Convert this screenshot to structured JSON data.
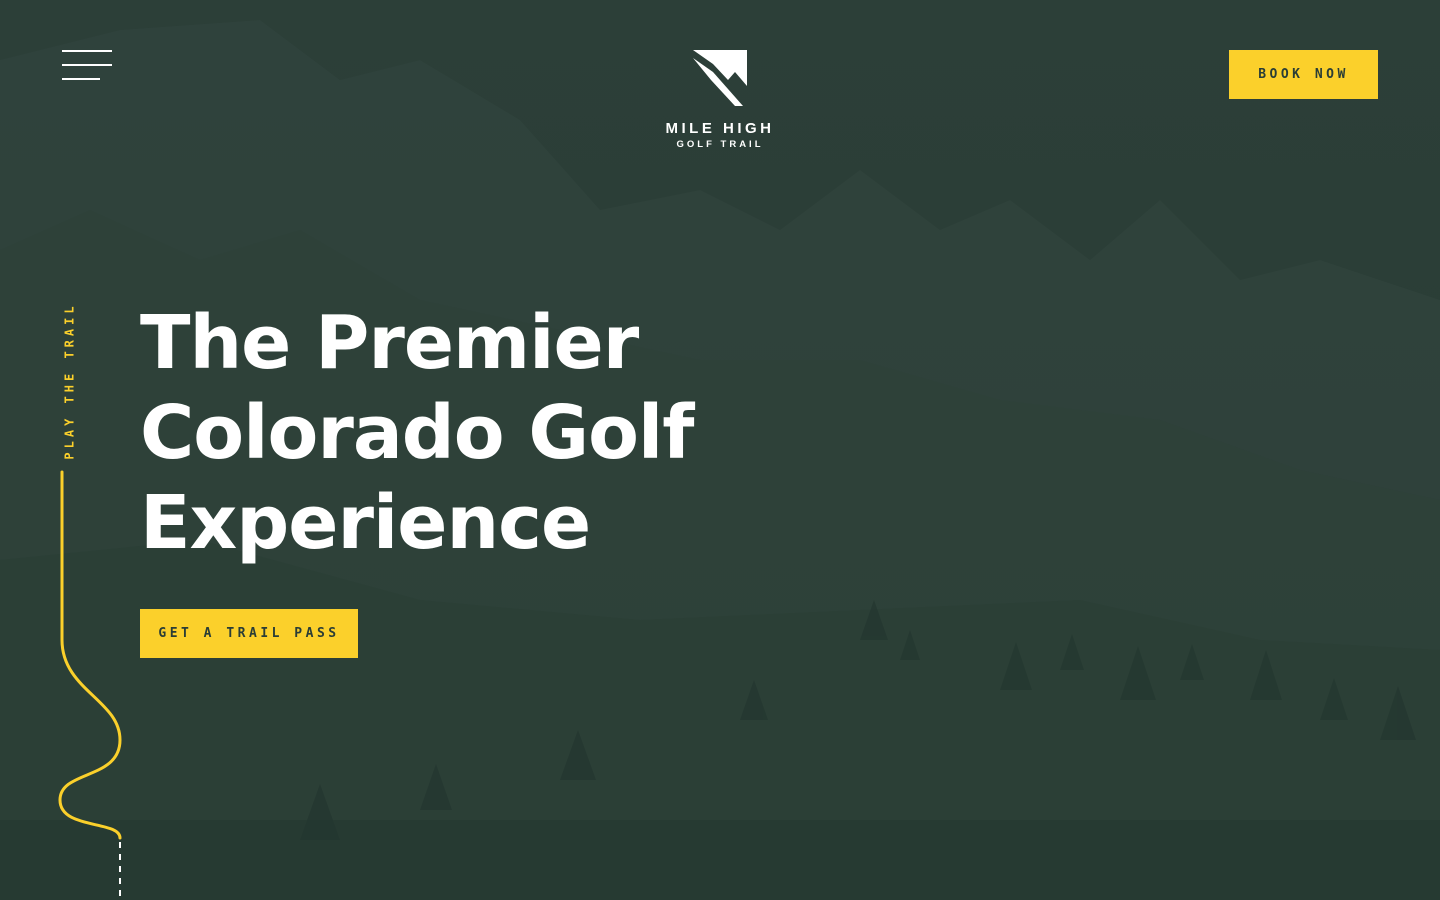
{
  "header": {
    "menu_icon": "hamburger-menu-icon",
    "logo": {
      "icon": "mountain-logo-icon",
      "line1": "MILE HIGH",
      "line2": "GOLF TRAIL"
    },
    "book_now_label": "BOOK NOW"
  },
  "sidebar": {
    "label": "PLAY THE TRAIL"
  },
  "hero": {
    "headline_lines": [
      "The Premier",
      "Colorado Golf",
      "Experience"
    ],
    "cta_label": "GET A TRAIL PASS"
  },
  "colors": {
    "background": "#2a3d36",
    "accent": "#fbd02b",
    "text": "#ffffff"
  }
}
